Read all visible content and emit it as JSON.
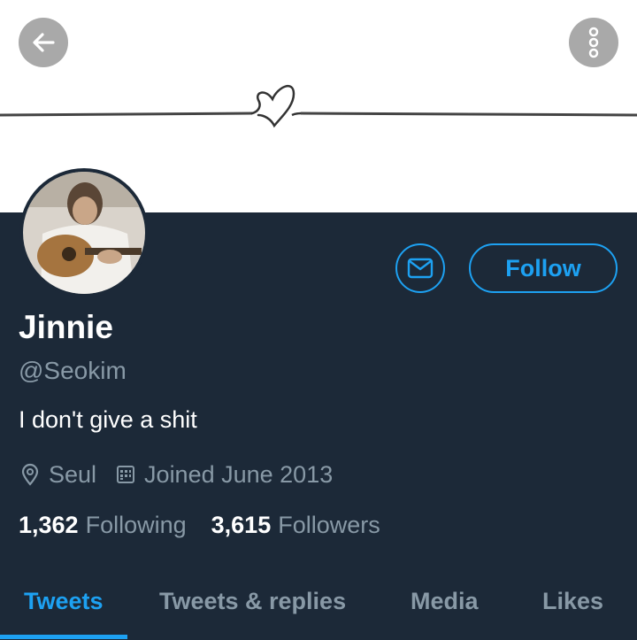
{
  "header": {
    "back_icon": "arrow-left-icon",
    "more_icon": "vertical-dots-icon",
    "banner_icon": "heart-line-icon"
  },
  "profile": {
    "name": "Jinnie",
    "handle": "@Seokim",
    "bio": "I don't give a shit",
    "location": "Seul",
    "joined": "Joined June 2013",
    "following_count": "1,362",
    "following_label": "Following",
    "followers_count": "3,615",
    "followers_label": "Followers"
  },
  "actions": {
    "message_icon": "envelope-icon",
    "follow_label": "Follow"
  },
  "tabs": [
    {
      "label": "Tweets",
      "active": true
    },
    {
      "label": "Tweets & replies",
      "active": false
    },
    {
      "label": "Media",
      "active": false
    },
    {
      "label": "Likes",
      "active": false
    }
  ],
  "colors": {
    "background": "#1c2938",
    "accent": "#1da1f2",
    "secondary_text": "#8899a6",
    "primary_text": "#ffffff"
  }
}
